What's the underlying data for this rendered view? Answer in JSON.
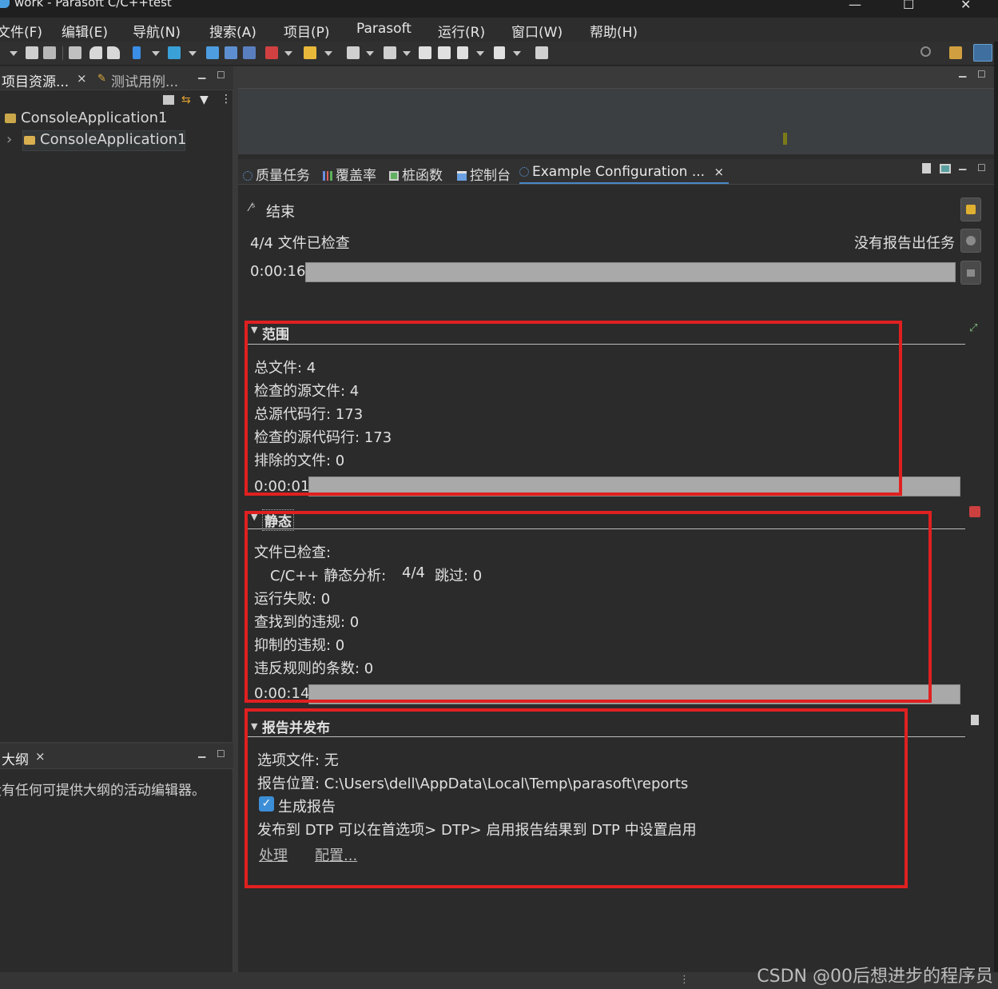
{
  "window": {
    "title": "work - Parasoft C/C++test",
    "minimize_glyph": "—",
    "maximize_glyph": "☐",
    "close_glyph": "✕"
  },
  "menu": [
    "文件(F)",
    "编辑(E)",
    "导航(N)",
    "搜索(A)",
    "项目(P)",
    "Parasoft",
    "运行(R)",
    "窗口(W)",
    "帮助(H)"
  ],
  "left_panel": {
    "tab_project": "项目资源...",
    "tab_tests": "测试用例...",
    "tree": [
      "ConsoleApplication1",
      "ConsoleApplication1"
    ],
    "expand_glyph": "›"
  },
  "outline_panel": {
    "tab": "大纲",
    "message": "没有任何可提供大纲的活动编辑器。"
  },
  "views": {
    "tabs": [
      "质量任务",
      "覆盖率",
      "桩函数",
      "控制台",
      "Example Configuration ..."
    ],
    "close_glyph": "×"
  },
  "progress": {
    "status": "结束",
    "files_checked": "4/4 文件已检查",
    "no_tasks": "没有报告出任务",
    "elapsed": "0:00:16",
    "overall_progress": 1.0
  },
  "scope": {
    "title": "范围",
    "lines": [
      "总文件: 4",
      "检查的源文件: 4",
      "总源代码行: 173",
      "检查的源代码行: 173",
      "排除的文件: 0"
    ],
    "time": "0:00:01",
    "progress": 1.0
  },
  "static": {
    "title": "静态",
    "checked_label": "文件已检查:",
    "analysis_name": "C/C++ 静态分析:",
    "analysis_count": "4/4",
    "skipped": "跳过: 0",
    "lines": [
      "运行失败: 0",
      "查找到的违规: 0",
      "抑制的违规: 0",
      "违反规则的条数: 0"
    ],
    "time": "0:00:14",
    "progress": 1.0
  },
  "report": {
    "title": "报告并发布",
    "options_file": "选项文件: 无",
    "location": "报告位置: C:\\Users\\dell\\AppData\\Local\\Temp\\parasoft\\reports",
    "generate_label": "生成报告",
    "generate_checked": true,
    "dtp_note": "发布到 DTP 可以在首选项> DTP> 启用报告结果到 DTP 中设置启用",
    "process_link": "处理",
    "configure_link": "配置..."
  },
  "watermark": "CSDN @00后想进步的程序员",
  "colors": {
    "highlight_box": "#e02020",
    "accent": "#4a88c7",
    "progress_fill": "#a9a9a9",
    "checkbox": "#3c8ed6"
  }
}
